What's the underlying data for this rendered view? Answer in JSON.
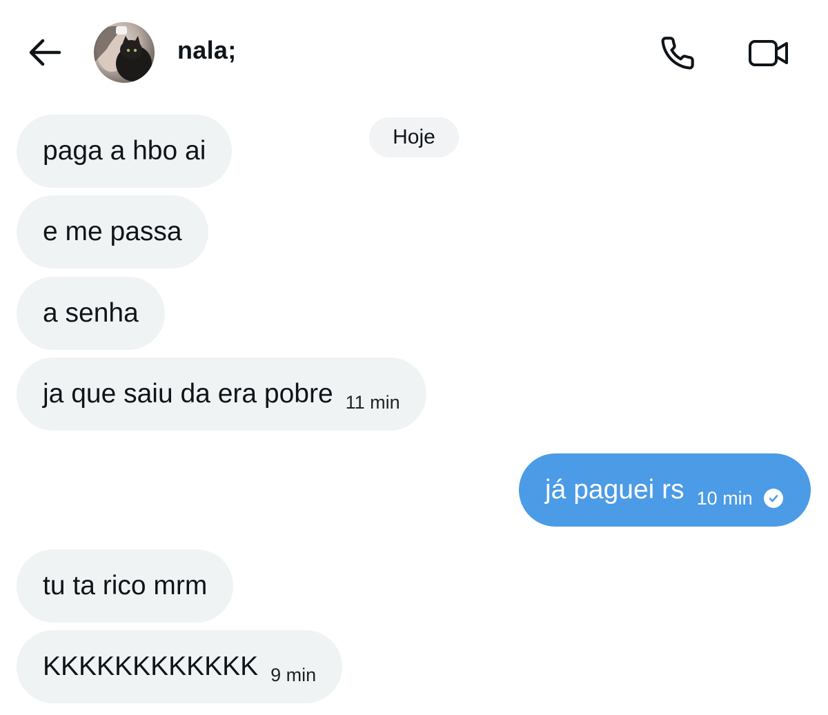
{
  "header": {
    "contact_name": "nala;",
    "icons": {
      "back": "arrow-left-icon",
      "call": "phone-icon",
      "video": "video-camera-icon"
    }
  },
  "date_divider": "Hoje",
  "messages": [
    {
      "direction": "incoming",
      "text": "paga a hbo ai",
      "time": ""
    },
    {
      "direction": "incoming",
      "text": "e me passa",
      "time": ""
    },
    {
      "direction": "incoming",
      "text": "a senha",
      "time": ""
    },
    {
      "direction": "incoming",
      "text": "ja que saiu da era pobre",
      "time": "11 min"
    },
    {
      "direction": "outgoing",
      "text": "já paguei rs",
      "time": "10 min",
      "status": "check-circle-icon"
    },
    {
      "direction": "incoming",
      "text": "tu ta rico mrm",
      "time": ""
    },
    {
      "direction": "incoming",
      "text": "KKKKKKKKKKKK",
      "time": "9 min"
    }
  ],
  "colors": {
    "incoming_bubble": "#eff3f4",
    "outgoing_bubble": "#4b9be6",
    "date_pill": "#f1f3f4"
  }
}
